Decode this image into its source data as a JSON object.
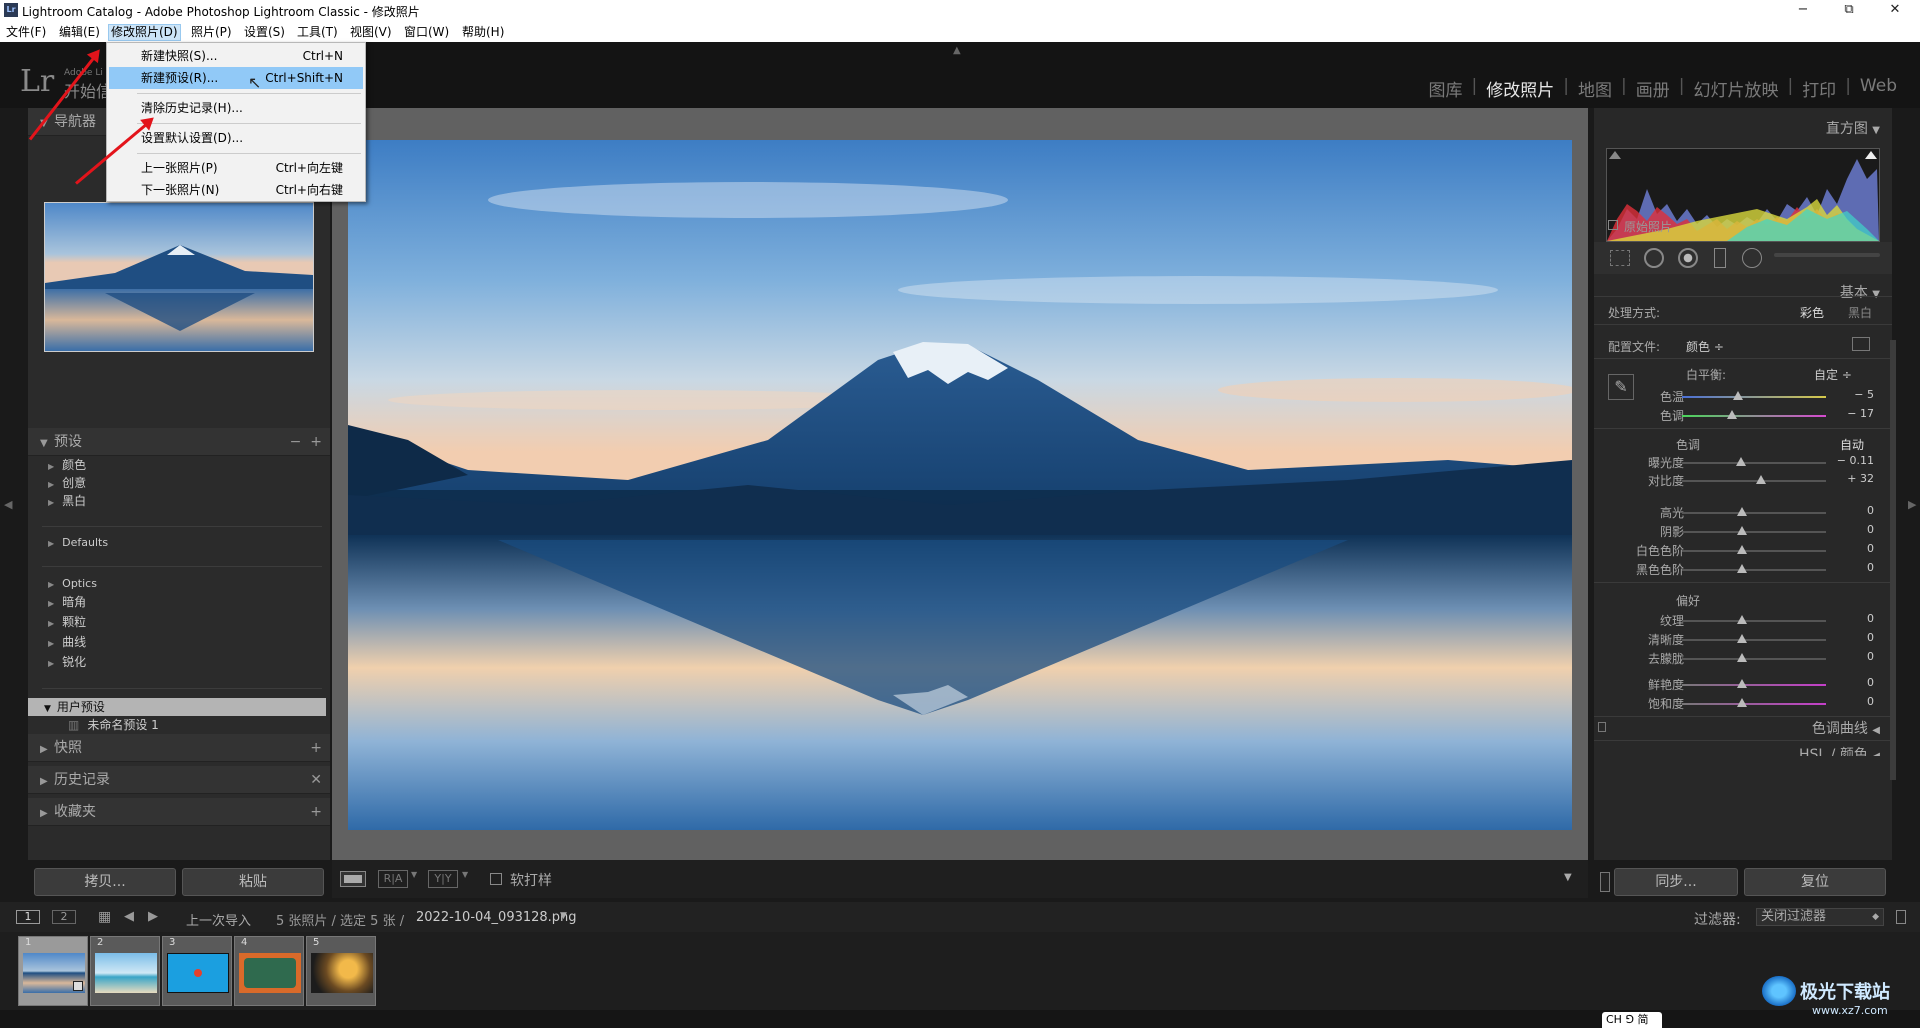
{
  "titlebar": {
    "app_icon": "Lr",
    "title": "Lightroom Catalog - Adobe Photoshop Lightroom Classic - 修改照片",
    "minimize": "−",
    "maximize": "⧉",
    "close": "✕"
  },
  "menubar": [
    "文件(F)",
    "编辑(E)",
    "修改照片(D)",
    "照片(P)",
    "设置(S)",
    "工具(T)",
    "视图(V)",
    "窗口(W)",
    "帮助(H)"
  ],
  "logo": {
    "mark": "Lr",
    "sub1": "Adobe Li",
    "sub2": "开始信"
  },
  "modules": [
    "图库",
    "修改照片",
    "地图",
    "画册",
    "幻灯片放映",
    "打印",
    "Web"
  ],
  "module_separator": "|",
  "active_module": "修改照片",
  "dropdown": [
    {
      "label": "新建快照(S)...",
      "shortcut": "Ctrl+N"
    },
    {
      "label": "新建预设(R)...",
      "shortcut": "Ctrl+Shift+N",
      "highlight": true
    },
    {
      "label": "清除历史记录(H)...",
      "shortcut": ""
    },
    {
      "label": "设置默认设置(D)...",
      "shortcut": ""
    },
    {
      "label": "上一张照片(P)",
      "shortcut": "Ctrl+向左键"
    },
    {
      "label": "下一张照片(N)",
      "shortcut": "Ctrl+向右键"
    }
  ],
  "left": {
    "navigator": "导航器",
    "presets": {
      "title": "预设",
      "minus": "−",
      "plus": "+",
      "groups": [
        "颜色",
        "创意",
        "黑白",
        "Defaults",
        "Optics",
        "暗角",
        "颗粒",
        "曲线",
        "锐化"
      ],
      "user_group": "用户预设",
      "user_item": "未命名预设 1"
    },
    "snapshots": "快照",
    "history": "历史记录",
    "collections": "收藏夹",
    "copy": "拷贝...",
    "paste": "粘贴"
  },
  "toolbar": {
    "ra": "R|A",
    "yy": "Y|Y",
    "softproof": "软打样"
  },
  "right": {
    "histogram": "直方图",
    "original": "原始照片",
    "basic": "基本",
    "treatment_label": "处理方式:",
    "color": "彩色",
    "bw": "黑白",
    "profile_label": "配置文件:",
    "profile": "颜色 ÷",
    "wb_label": "白平衡:",
    "wb": "自定 ÷",
    "temp": {
      "label": "色温",
      "value": "− 5",
      "pos": 0.39
    },
    "tint": {
      "label": "色调",
      "value": "− 17",
      "pos": 0.35
    },
    "tone": "色调",
    "auto": "自动",
    "exposure": {
      "label": "曝光度",
      "value": "− 0.11",
      "pos": 0.41
    },
    "contrast": {
      "label": "对比度",
      "value": "+ 32",
      "pos": 0.55
    },
    "highlights": {
      "label": "高光",
      "value": "0",
      "pos": 0.42
    },
    "shadows": {
      "label": "阴影",
      "value": "0",
      "pos": 0.42
    },
    "whites": {
      "label": "白色色阶",
      "value": "0",
      "pos": 0.42
    },
    "blacks": {
      "label": "黑色色阶",
      "value": "0",
      "pos": 0.42
    },
    "presence": "偏好",
    "texture": {
      "label": "纹理",
      "value": "0",
      "pos": 0.42
    },
    "clarity": {
      "label": "清晰度",
      "value": "0",
      "pos": 0.42
    },
    "dehaze": {
      "label": "去朦胧",
      "value": "0",
      "pos": 0.42
    },
    "vibrance": {
      "label": "鲜艳度",
      "value": "0",
      "pos": 0.42
    },
    "saturation": {
      "label": "饱和度",
      "value": "0",
      "pos": 0.42
    },
    "tone_curve": "色调曲线",
    "hsl": "HSL / 颜色",
    "sync": "同步...",
    "reset": "复位"
  },
  "filmstrip": {
    "page1": "1",
    "page2": "2",
    "source": "上一次导入",
    "count": "5 张照片 / 选定 5 张 /",
    "file": "2022-10-04_093128.png",
    "filter_label": "过滤器:",
    "filter": "关闭过滤器",
    "thumbs": [
      "1",
      "2",
      "3",
      "4",
      "5"
    ]
  },
  "ime": "CH ⅁ 简",
  "watermark": "极光下载站",
  "watermark_url": "www.xz7.com"
}
